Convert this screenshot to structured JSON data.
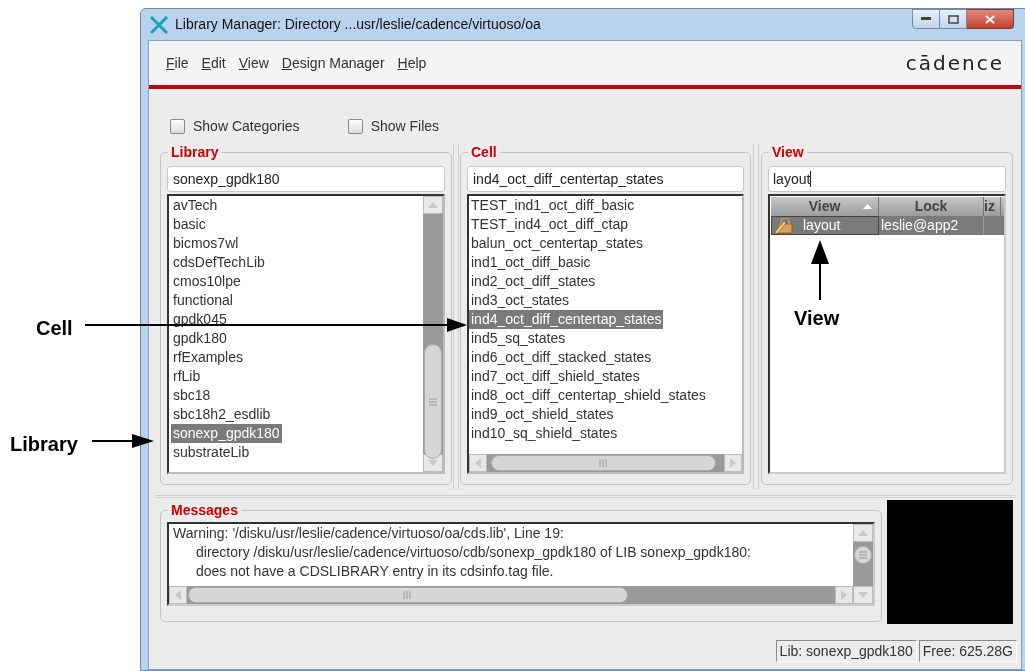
{
  "window": {
    "title": "Library Manager: Directory ...usr/leslie/cadence/virtuoso/oa"
  },
  "menu": [
    "File",
    "Edit",
    "View",
    "Design Manager",
    "Help"
  ],
  "logo": "cādence",
  "options": [
    {
      "label": "Show Categories",
      "checked": false
    },
    {
      "label": "Show Files",
      "checked": false
    }
  ],
  "library": {
    "title": "Library",
    "value": "sonexp_gpdk180",
    "items": [
      {
        "label": "avTech",
        "selected": false
      },
      {
        "label": "basic",
        "selected": false
      },
      {
        "label": "bicmos7wl",
        "selected": false
      },
      {
        "label": "cdsDefTechLib",
        "selected": false
      },
      {
        "label": "cmos10lpe",
        "selected": false
      },
      {
        "label": "functional",
        "selected": false
      },
      {
        "label": "gpdk045",
        "selected": false
      },
      {
        "label": "gpdk180",
        "selected": false
      },
      {
        "label": "rfExamples",
        "selected": false
      },
      {
        "label": "rfLib",
        "selected": false
      },
      {
        "label": "sbc18",
        "selected": false
      },
      {
        "label": "sbc18h2_esdlib",
        "selected": false
      },
      {
        "label": "sonexp_gpdk180",
        "selected": true
      },
      {
        "label": "substrateLib",
        "selected": false
      }
    ]
  },
  "cell": {
    "title": "Cell",
    "value": "ind4_oct_diff_centertap_states",
    "items": [
      {
        "label": "TEST_ind1_oct_diff_basic",
        "selected": false
      },
      {
        "label": "TEST_ind4_oct_diff_ctap",
        "selected": false
      },
      {
        "label": "balun_oct_centertap_states",
        "selected": false
      },
      {
        "label": "ind1_oct_diff_basic",
        "selected": false
      },
      {
        "label": "ind2_oct_diff_states",
        "selected": false
      },
      {
        "label": "ind3_oct_states",
        "selected": false
      },
      {
        "label": "ind4_oct_diff_centertap_states",
        "selected": true
      },
      {
        "label": "ind5_sq_states",
        "selected": false
      },
      {
        "label": "ind6_oct_diff_stacked_states",
        "selected": false
      },
      {
        "label": "ind7_oct_diff_shield_states",
        "selected": false
      },
      {
        "label": "ind8_oct_diff_centertap_shield_states",
        "selected": false
      },
      {
        "label": "ind9_oct_shield_states",
        "selected": false
      },
      {
        "label": "ind10_sq_shield_states",
        "selected": false
      }
    ]
  },
  "view": {
    "title": "View",
    "value": "layout",
    "columns": [
      "View",
      "Lock",
      "iz"
    ],
    "rows": [
      {
        "view": "layout",
        "lock": "leslie@app2",
        "selected": true
      }
    ]
  },
  "messages": {
    "title": "Messages",
    "lines": [
      "Warning: '/disku/usr/leslie/cadence/virtuoso/oa/cds.lib', Line 19:",
      "directory /disku/usr/leslie/cadence/virtuoso/cdb/sonexp_gpdk180 of LIB sonexp_gpdk180:",
      "does not have a CDSLIBRARY entry in its cdsinfo.tag file."
    ]
  },
  "status_bar": [
    "Lib: sonexp_gpdk180",
    "Free: 625.28G"
  ],
  "callouts": [
    "Cell",
    "Library",
    "View"
  ]
}
